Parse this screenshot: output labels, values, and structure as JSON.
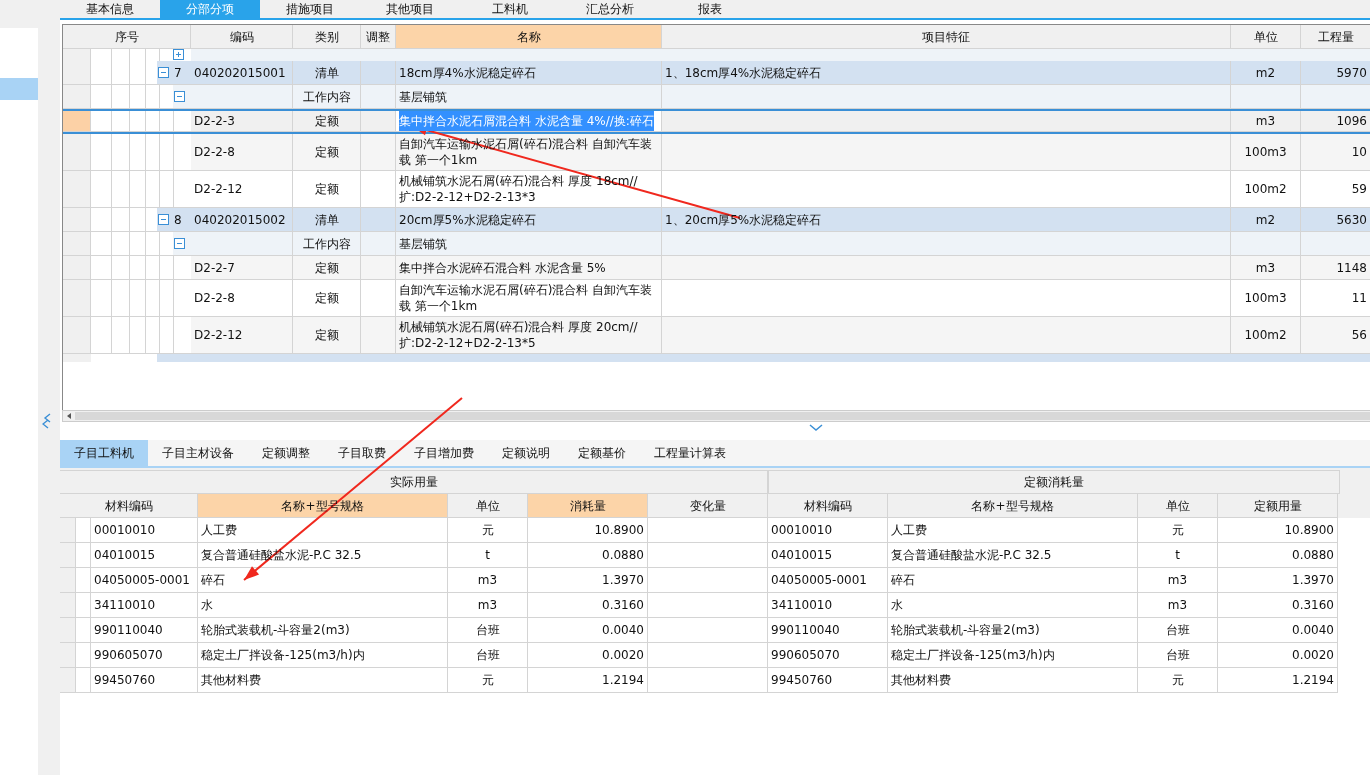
{
  "top_tabs": [
    {
      "label": "基本信息",
      "selected": false
    },
    {
      "label": "分部分项",
      "selected": true
    },
    {
      "label": "措施项目",
      "selected": false
    },
    {
      "label": "其他项目",
      "selected": false
    },
    {
      "label": "工料机",
      "selected": false
    },
    {
      "label": "汇总分析",
      "selected": false
    },
    {
      "label": "报表",
      "selected": false
    }
  ],
  "upper_table": {
    "columns": [
      "序号",
      "编码",
      "类别",
      "调整",
      "名称",
      "项目特征",
      "单位",
      "工程量"
    ],
    "rows": [
      {
        "kind": "bill",
        "expanded": true,
        "selected": false,
        "no": "7",
        "code": "040202015001",
        "type": "清单",
        "name": "18cm厚4%水泥稳定碎石",
        "feature": "1、18cm厚4%水泥稳定碎石",
        "unit": "m2",
        "qty": "5970"
      },
      {
        "kind": "work",
        "expanded": true,
        "selected": false,
        "type": "工作内容",
        "name": "基层铺筑"
      },
      {
        "kind": "quota",
        "selected": true,
        "code": "D2-2-3",
        "type": "定额",
        "name": "集中拌合水泥石屑混合料 水泥含量 4%//换:碎石",
        "unit": "m3",
        "qty": "1096"
      },
      {
        "kind": "quota",
        "selected": false,
        "code": "D2-2-8",
        "type": "定额",
        "name": "自卸汽车运输水泥石屑(碎石)混合料 自卸汽车装载 第一个1km",
        "unit": "100m3",
        "qty": "10"
      },
      {
        "kind": "quota",
        "selected": false,
        "code": "D2-2-12",
        "type": "定额",
        "name": "机械铺筑水泥石屑(碎石)混合料 厚度 18cm//扩:D2-2-12+D2-2-13*3",
        "unit": "100m2",
        "qty": "59"
      },
      {
        "kind": "bill",
        "expanded": true,
        "selected": false,
        "no": "8",
        "code": "040202015002",
        "type": "清单",
        "name": "20cm厚5%水泥稳定碎石",
        "feature": "1、20cm厚5%水泥稳定碎石",
        "unit": "m2",
        "qty": "5630"
      },
      {
        "kind": "work",
        "expanded": true,
        "selected": false,
        "type": "工作内容",
        "name": "基层铺筑"
      },
      {
        "kind": "quota",
        "selected": false,
        "code": "D2-2-7",
        "type": "定额",
        "name": "集中拌合水泥碎石混合料 水泥含量 5%",
        "unit": "m3",
        "qty": "1148"
      },
      {
        "kind": "quota",
        "selected": false,
        "code": "D2-2-8",
        "type": "定额",
        "name": "自卸汽车运输水泥石屑(碎石)混合料 自卸汽车装载 第一个1km",
        "unit": "100m3",
        "qty": "11"
      },
      {
        "kind": "quota",
        "selected": false,
        "code": "D2-2-12",
        "type": "定额",
        "name": "机械铺筑水泥石屑(碎石)混合料 厚度 20cm//扩:D2-2-12+D2-2-13*5",
        "unit": "100m2",
        "qty": "56"
      }
    ]
  },
  "bottom_tabs": [
    {
      "label": "子目工料机",
      "selected": true
    },
    {
      "label": "子目主材设备",
      "selected": false
    },
    {
      "label": "定额调整",
      "selected": false
    },
    {
      "label": "子目取费",
      "selected": false
    },
    {
      "label": "子目增加费",
      "selected": false
    },
    {
      "label": "定额说明",
      "selected": false
    },
    {
      "label": "定额基价",
      "selected": false
    },
    {
      "label": "工程量计算表",
      "selected": false
    }
  ],
  "lower_table": {
    "groups": [
      "实际用量",
      "定额消耗量"
    ],
    "actual_columns": [
      "材料编码",
      "名称+型号规格",
      "单位",
      "消耗量",
      "变化量"
    ],
    "quota_columns": [
      "材料编码",
      "名称+型号规格",
      "单位",
      "定额用量"
    ],
    "rows": [
      {
        "actual": {
          "code": "00010010",
          "name": "人工费",
          "unit": "元",
          "consumption": "10.8900"
        },
        "quota": {
          "code": "00010010",
          "name": "人工费",
          "unit": "元",
          "amount": "10.8900"
        }
      },
      {
        "actual": {
          "code": "04010015",
          "name": "复合普通硅酸盐水泥-P.C 32.5",
          "unit": "t",
          "consumption": "0.0880"
        },
        "quota": {
          "code": "04010015",
          "name": "复合普通硅酸盐水泥-P.C 32.5",
          "unit": "t",
          "amount": "0.0880"
        }
      },
      {
        "actual": {
          "code": "04050005-0001",
          "name": "碎石",
          "unit": "m3",
          "consumption": "1.3970"
        },
        "quota": {
          "code": "04050005-0001",
          "name": "碎石",
          "unit": "m3",
          "amount": "1.3970"
        }
      },
      {
        "actual": {
          "code": "34110010",
          "name": "水",
          "unit": "m3",
          "consumption": "0.3160"
        },
        "quota": {
          "code": "34110010",
          "name": "水",
          "unit": "m3",
          "amount": "0.3160"
        }
      },
      {
        "actual": {
          "code": "990110040",
          "name": "轮胎式装载机-斗容量2(m3)",
          "unit": "台班",
          "consumption": "0.0040"
        },
        "quota": {
          "code": "990110040",
          "name": "轮胎式装载机-斗容量2(m3)",
          "unit": "台班",
          "amount": "0.0040"
        }
      },
      {
        "actual": {
          "code": "990605070",
          "name": "稳定土厂拌设备-125(m3/h)内",
          "unit": "台班",
          "consumption": "0.0020"
        },
        "quota": {
          "code": "990605070",
          "name": "稳定土厂拌设备-125(m3/h)内",
          "unit": "台班",
          "amount": "0.0020"
        }
      },
      {
        "actual": {
          "code": "99450760",
          "name": "其他材料费",
          "unit": "元",
          "consumption": "1.2194"
        },
        "quota": {
          "code": "99450760",
          "name": "其他材料费",
          "unit": "元",
          "amount": "1.2194"
        }
      }
    ]
  }
}
